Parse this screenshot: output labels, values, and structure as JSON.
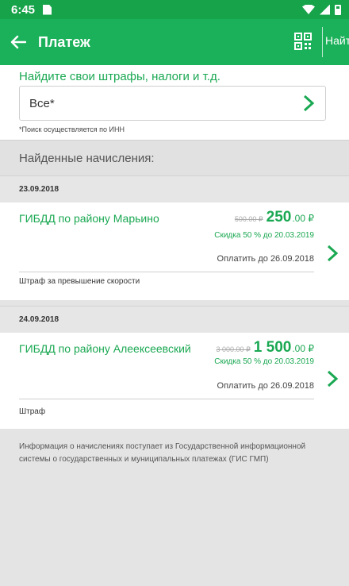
{
  "status_bar": {
    "time": "6:45"
  },
  "app_bar": {
    "title": "Платеж",
    "find_label": "Найти"
  },
  "search": {
    "heading": "Найдите свои штрафы, налоги и т.д.",
    "value": "Все*",
    "note": "*Поиск осуществляется по ИНН"
  },
  "results_header": "Найденные начисления:",
  "charges": [
    {
      "date": "23.09.2018",
      "organization": "ГИБДД по району Марьино",
      "old_price": "500.00 ₽",
      "new_price_int": "250",
      "new_price_dec": ".00 ₽",
      "discount": "Скидка 50 % до 20.03.2019",
      "pay_before": "Оплатить до 26.09.2018",
      "description": "Штраф за превышение скорости"
    },
    {
      "date": "24.09.2018",
      "organization": "ГИБДД по району Алеексеевский",
      "old_price": "3 000.00 ₽",
      "new_price_int": "1 500",
      "new_price_dec": ".00 ₽",
      "discount": "Скидка 50 % до 20.03.2019",
      "pay_before": "Оплатить до 26.09.2018",
      "description": "Штраф"
    }
  ],
  "footer_note": "Информация о начислениях поступает из Государственной информационной системы о государственных и муниципальных платежах (ГИС ГМП)",
  "colors": {
    "primary": "#1bb15a",
    "status_bar": "#17a34a",
    "accent_text": "#1aa852"
  }
}
